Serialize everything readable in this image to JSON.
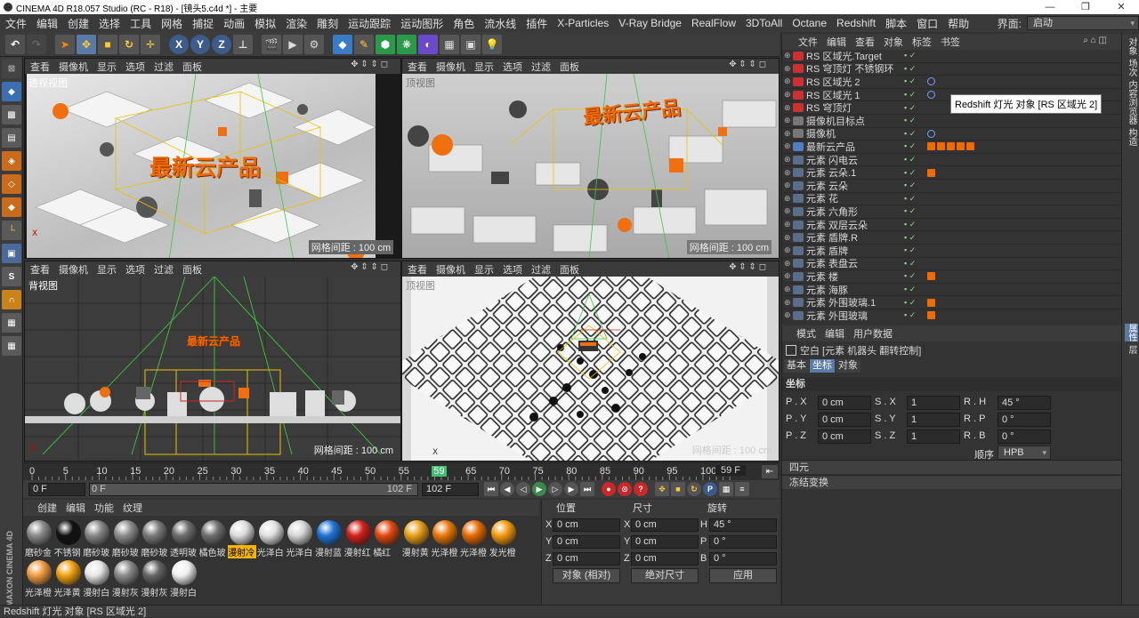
{
  "window": {
    "title": "CINEMA 4D R18.057 Studio (RC - R18) - [镜头5.c4d *] - 主要",
    "controls": [
      "—",
      "❐",
      "✕"
    ]
  },
  "menubar": {
    "items": [
      "文件",
      "编辑",
      "创建",
      "选择",
      "工具",
      "网格",
      "捕捉",
      "动画",
      "模拟",
      "渲染",
      "雕刻",
      "运动跟踪",
      "运动图形",
      "角色",
      "流水线",
      "插件",
      "X-Particles",
      "V-Ray Bridge",
      "RealFlow",
      "3DToAll",
      "Octane",
      "Redshift",
      "脚本",
      "窗口",
      "帮助"
    ],
    "interface_label": "界面:",
    "interface_value": "启动"
  },
  "viewports": [
    {
      "id": "persp",
      "label": "透视视图",
      "menu": [
        "查看",
        "摄像机",
        "显示",
        "选项",
        "过滤",
        "面板"
      ],
      "grid": "网格间距 : 100 cm",
      "title_text": "最新云产品"
    },
    {
      "id": "top-right",
      "label": "顶视图",
      "menu": [
        "查看",
        "摄像机",
        "显示",
        "选项",
        "过滤",
        "面板"
      ],
      "grid": "网格间距 : 100 cm",
      "title_text": "最新云产品"
    },
    {
      "id": "back",
      "label": "背视图",
      "menu": [
        "查看",
        "摄像机",
        "显示",
        "选项",
        "过滤",
        "面板"
      ],
      "grid": "网格间距 : 100 cm",
      "title_text": "最新云产品"
    },
    {
      "id": "top",
      "label": "顶视图",
      "menu": [
        "查看",
        "摄像机",
        "显示",
        "选项",
        "过滤",
        "面板"
      ],
      "grid": "网格间距 : 100 cm"
    }
  ],
  "timeline": {
    "ticks": [
      "0",
      "5",
      "10",
      "15",
      "20",
      "25",
      "30",
      "35",
      "40",
      "45",
      "50",
      "55",
      "59",
      "65",
      "70",
      "75",
      "80",
      "85",
      "90",
      "95",
      "100"
    ],
    "current_frame": "59",
    "end_display": "59 F",
    "start_field": "0 F",
    "range_start": "0 F",
    "range_end": "102 F",
    "max_field": "102 F"
  },
  "materials": {
    "menu": [
      "创建",
      "编辑",
      "功能",
      "纹理"
    ],
    "brand": "MAXON CINEMA 4D",
    "items": [
      {
        "label": "磨砂金",
        "color": "#8a8a8a"
      },
      {
        "label": "不锈钢",
        "color": "#111111"
      },
      {
        "label": "磨砂玻",
        "color": "#888888"
      },
      {
        "label": "磨砂玻",
        "color": "#8d8d8d"
      },
      {
        "label": "磨砂玻",
        "color": "#7a7a7a"
      },
      {
        "label": "透明玻",
        "color": "#6d6d6d"
      },
      {
        "label": "橘色玻",
        "color": "#707070"
      },
      {
        "label": "漫射冷",
        "color": "#dddddd",
        "highlight": true
      },
      {
        "label": "光泽白",
        "color": "#e0e0e0"
      },
      {
        "label": "光泽白",
        "color": "#d6d6d6"
      },
      {
        "label": "漫射蓝",
        "color": "#1f74d6"
      },
      {
        "label": "漫射红",
        "color": "#d2201a"
      },
      {
        "label": "橘红",
        "color": "#e24a10"
      },
      {
        "label": "漫射黄",
        "color": "#e8a017"
      },
      {
        "label": "光泽橙",
        "color": "#e87808"
      },
      {
        "label": "光泽橙",
        "color": "#e66a06"
      },
      {
        "label": "发光橙",
        "color": "#f59a10"
      },
      {
        "label": "光泽橙",
        "color": "#f09a40"
      },
      {
        "label": "光泽黄",
        "color": "#f0a010"
      },
      {
        "label": "漫射白",
        "color": "#e6e6e6"
      },
      {
        "label": "漫射灰",
        "color": "#8a8a8a"
      },
      {
        "label": "漫射灰",
        "color": "#666666"
      },
      {
        "label": "漫射白",
        "color": "#f0f0f0"
      }
    ]
  },
  "coords": {
    "headers": [
      "位置",
      "尺寸",
      "旋转"
    ],
    "rows": [
      {
        "axis": "X",
        "pos": "0 cm",
        "size": "0 cm",
        "rot_label": "H",
        "rot": "45 °"
      },
      {
        "axis": "Y",
        "pos": "0 cm",
        "size": "0 cm",
        "rot_label": "P",
        "rot": "0 °"
      },
      {
        "axis": "Z",
        "pos": "0 cm",
        "size": "0 cm",
        "rot_label": "B",
        "rot": "0 °"
      }
    ],
    "mode1": "对象 (相对)",
    "mode2": "绝对尺寸",
    "apply": "应用"
  },
  "objects": {
    "menu": [
      "文件",
      "编辑",
      "查看",
      "对象",
      "标签",
      "书签"
    ],
    "rows": [
      {
        "name": "RS 区域光.Target",
        "icon": "#cc3030",
        "tags": []
      },
      {
        "name": "RS 穹顶灯 不锈钢环",
        "icon": "#cc3030",
        "tags": []
      },
      {
        "name": "RS 区域光 2",
        "icon": "#cc3030",
        "tags": [
          "target"
        ]
      },
      {
        "name": "RS 区域光 1",
        "icon": "#cc3030",
        "tags": [
          "target"
        ]
      },
      {
        "name": "RS 穹顶灯",
        "icon": "#cc3030",
        "tags": []
      },
      {
        "name": "摄像机目标点",
        "icon": "#777777",
        "tags": []
      },
      {
        "name": "摄像机",
        "icon": "#777777",
        "tags": [
          "target"
        ]
      },
      {
        "name": "最新云产品",
        "icon": "#4f7fc4",
        "tags": [
          "mat",
          "mat",
          "mat",
          "mat",
          "mat"
        ]
      },
      {
        "name": "元素  闪电云",
        "icon": "#5a6e8a",
        "tags": []
      },
      {
        "name": "元素  云朵.1",
        "icon": "#5a6e8a",
        "tags": [
          "mat"
        ]
      },
      {
        "name": "元素  云朵",
        "icon": "#5a6e8a",
        "tags": []
      },
      {
        "name": "元素  花",
        "icon": "#5a6e8a",
        "tags": []
      },
      {
        "name": "元素  六角形",
        "icon": "#5a6e8a",
        "tags": []
      },
      {
        "name": "元素  双层云朵",
        "icon": "#5a6e8a",
        "tags": []
      },
      {
        "name": "元素  盾牌.R",
        "icon": "#5a6e8a",
        "tags": []
      },
      {
        "name": "元素  盾牌",
        "icon": "#5a6e8a",
        "tags": []
      },
      {
        "name": "元素  表盘云",
        "icon": "#5a6e8a",
        "tags": []
      },
      {
        "name": "元素  楼",
        "icon": "#5a6e8a",
        "tags": [
          "mat"
        ]
      },
      {
        "name": "元素  海豚",
        "icon": "#5a6e8a",
        "tags": []
      },
      {
        "name": "元素  外围玻璃.1",
        "icon": "#5a6e8a",
        "tags": [
          "mat"
        ]
      },
      {
        "name": "元素  外围玻璃",
        "icon": "#5a6e8a",
        "tags": [
          "mat"
        ]
      }
    ],
    "tooltip": "Redshift 灯光 对象 [RS 区域光 2]"
  },
  "attributes": {
    "menu": [
      "模式",
      "编辑",
      "用户数据"
    ],
    "object_line": "空白 [元素  机器头  翻转控制]",
    "tabs": [
      "基本",
      "坐标",
      "对象"
    ],
    "active_tab": "坐标",
    "section": "坐标",
    "fields": [
      {
        "p_label": "P . X",
        "p": "0 cm",
        "s_label": "S . X",
        "s": "1",
        "r_label": "R . H",
        "r": "45 °"
      },
      {
        "p_label": "P . Y",
        "p": "0 cm",
        "s_label": "S . Y",
        "s": "1",
        "r_label": "R . P",
        "r": "0 °"
      },
      {
        "p_label": "P . Z",
        "p": "0 cm",
        "s_label": "S . Z",
        "s": "1",
        "r_label": "R . B",
        "r": "0 °"
      }
    ],
    "order_label": "顺序",
    "order_value": "HPB",
    "collapsed": [
      "四元",
      "冻结变换"
    ]
  },
  "right_tabs": [
    "对象",
    "场次",
    "内容浏览器",
    "构造",
    "属性",
    "层"
  ],
  "status": "Redshift 灯光 对象 [RS 区域光 2]",
  "colors": {
    "accent": "#f06a00",
    "selection": "#5a7ba6",
    "timeline_marker": "#3fbf6f"
  }
}
